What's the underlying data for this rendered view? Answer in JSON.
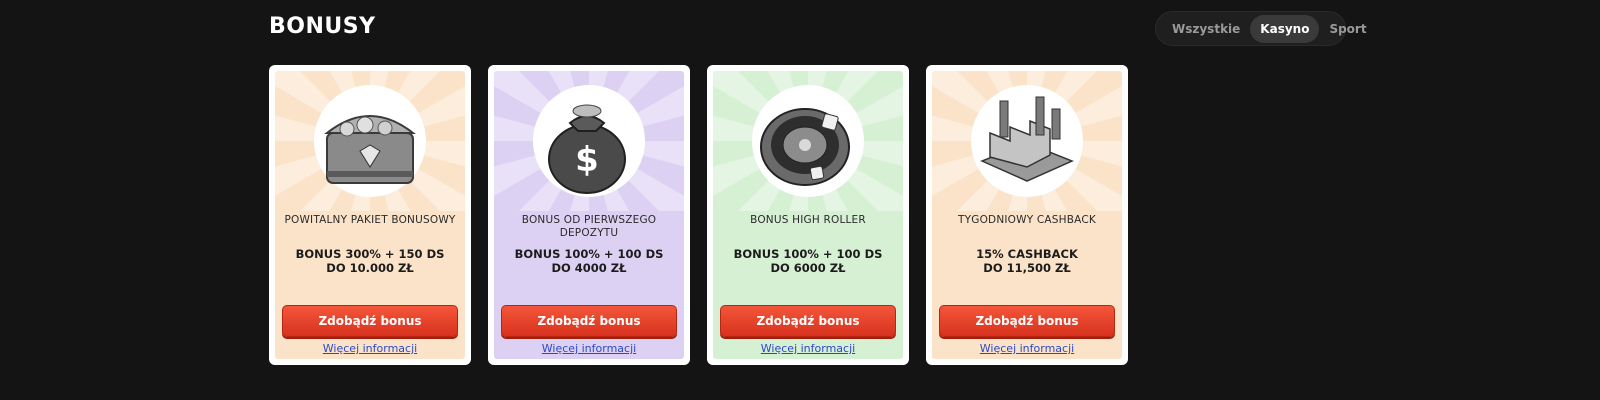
{
  "page": {
    "title": "BONUSY"
  },
  "filters": [
    {
      "label": "Wszystkie",
      "active": false
    },
    {
      "label": "Kasyno",
      "active": true
    },
    {
      "label": "Sport",
      "active": false
    }
  ],
  "cards": [
    {
      "icon": "treasure-chest-icon",
      "bg_color": "#fbe3c9",
      "title": "POWITALNY PAKIET BONUSOWY",
      "offer_line1": "BONUS 300% + 150 DS",
      "offer_line2": "DO 10.000 ZŁ",
      "button": "Zdobądź bonus",
      "link": "Więcej informacji"
    },
    {
      "icon": "money-bag-icon",
      "bg_color": "#ddd1f3",
      "title": "BONUS OD PIERWSZEGO DEPOZYTU",
      "offer_line1": "BONUS 100% + 100 DS",
      "offer_line2": "DO 4000 ZŁ",
      "button": "Zdobądź bonus",
      "link": "Więcej informacji"
    },
    {
      "icon": "roulette-wheel-icon",
      "bg_color": "#d6f0d4",
      "title": "BONUS HIGH ROLLER",
      "offer_line1": "BONUS 100% + 100 DS",
      "offer_line2": "DO 6000 ZŁ",
      "button": "Zdobądź bonus",
      "link": "Więcej informacji"
    },
    {
      "icon": "factory-icon",
      "bg_color": "#fbe3c9",
      "title": "TYGODNIOWY CASHBACK",
      "offer_line1": "15% CASHBACK",
      "offer_line2": "DO 11,500 ZŁ",
      "button": "Zdobądź bonus",
      "link": "Więcej informacji"
    }
  ],
  "colors": {
    "background": "#141414",
    "button": "#e53f25",
    "link": "#2c49c9"
  }
}
